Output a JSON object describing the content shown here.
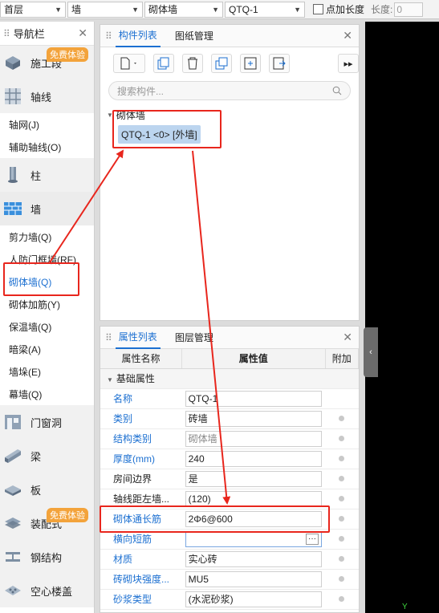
{
  "topbar": {
    "floor": "首层",
    "type": "墙",
    "subtype": "砌体墙",
    "component": "QTQ-1",
    "point_length_label": "点加长度",
    "length_label": "长度:",
    "length_value": "0"
  },
  "nav": {
    "title": "导航栏",
    "badge": "免费体验",
    "cats": {
      "construction": "施工段",
      "axis": "轴线",
      "column": "柱",
      "wall": "墙",
      "door": "门窗洞",
      "beam": "梁",
      "slab": "板",
      "decor": "装配式",
      "steel": "钢结构",
      "hollow": "空心楼盖"
    },
    "axis_items": [
      "轴网(J)",
      "辅助轴线(O)"
    ],
    "wall_items": [
      "剪力墙(Q)",
      "人防门框墙(RF)",
      "砌体墙(Q)",
      "砌体加筋(Y)",
      "保温墙(Q)",
      "暗梁(A)",
      "墙垛(E)",
      "幕墙(Q)"
    ]
  },
  "component_panel": {
    "tab_active": "构件列表",
    "tab_other": "图纸管理",
    "search_placeholder": "搜索构件...",
    "tree_root": "砌体墙",
    "tree_node": "QTQ-1 <0> [外墙]"
  },
  "prop_panel": {
    "tab_active": "属性列表",
    "tab_other": "图层管理",
    "col_name": "属性名称",
    "col_value": "属性值",
    "col_extra": "附加",
    "group": "基础属性",
    "rows": [
      {
        "name": "名称",
        "value": "QTQ-1"
      },
      {
        "name": "类别",
        "value": "砖墙"
      },
      {
        "name": "结构类别",
        "value": "砌体墙"
      },
      {
        "name": "厚度(mm)",
        "value": "240"
      },
      {
        "name": "房间边界",
        "value": "是"
      },
      {
        "name": "轴线距左墙...",
        "value": "(120)"
      },
      {
        "name": "砌体通长筋",
        "value": "2Φ6@600"
      },
      {
        "name": "横向短筋",
        "value": ""
      },
      {
        "name": "材质",
        "value": "实心砖"
      },
      {
        "name": "砖砌块强度...",
        "value": "MU5"
      },
      {
        "name": "砂浆类型",
        "value": "(水泥砂浆)"
      }
    ],
    "ellipsis": "···"
  },
  "canvas": {
    "handle_glyph": "‹",
    "axis_y": "Y"
  },
  "annotation_color": "#e8261d"
}
